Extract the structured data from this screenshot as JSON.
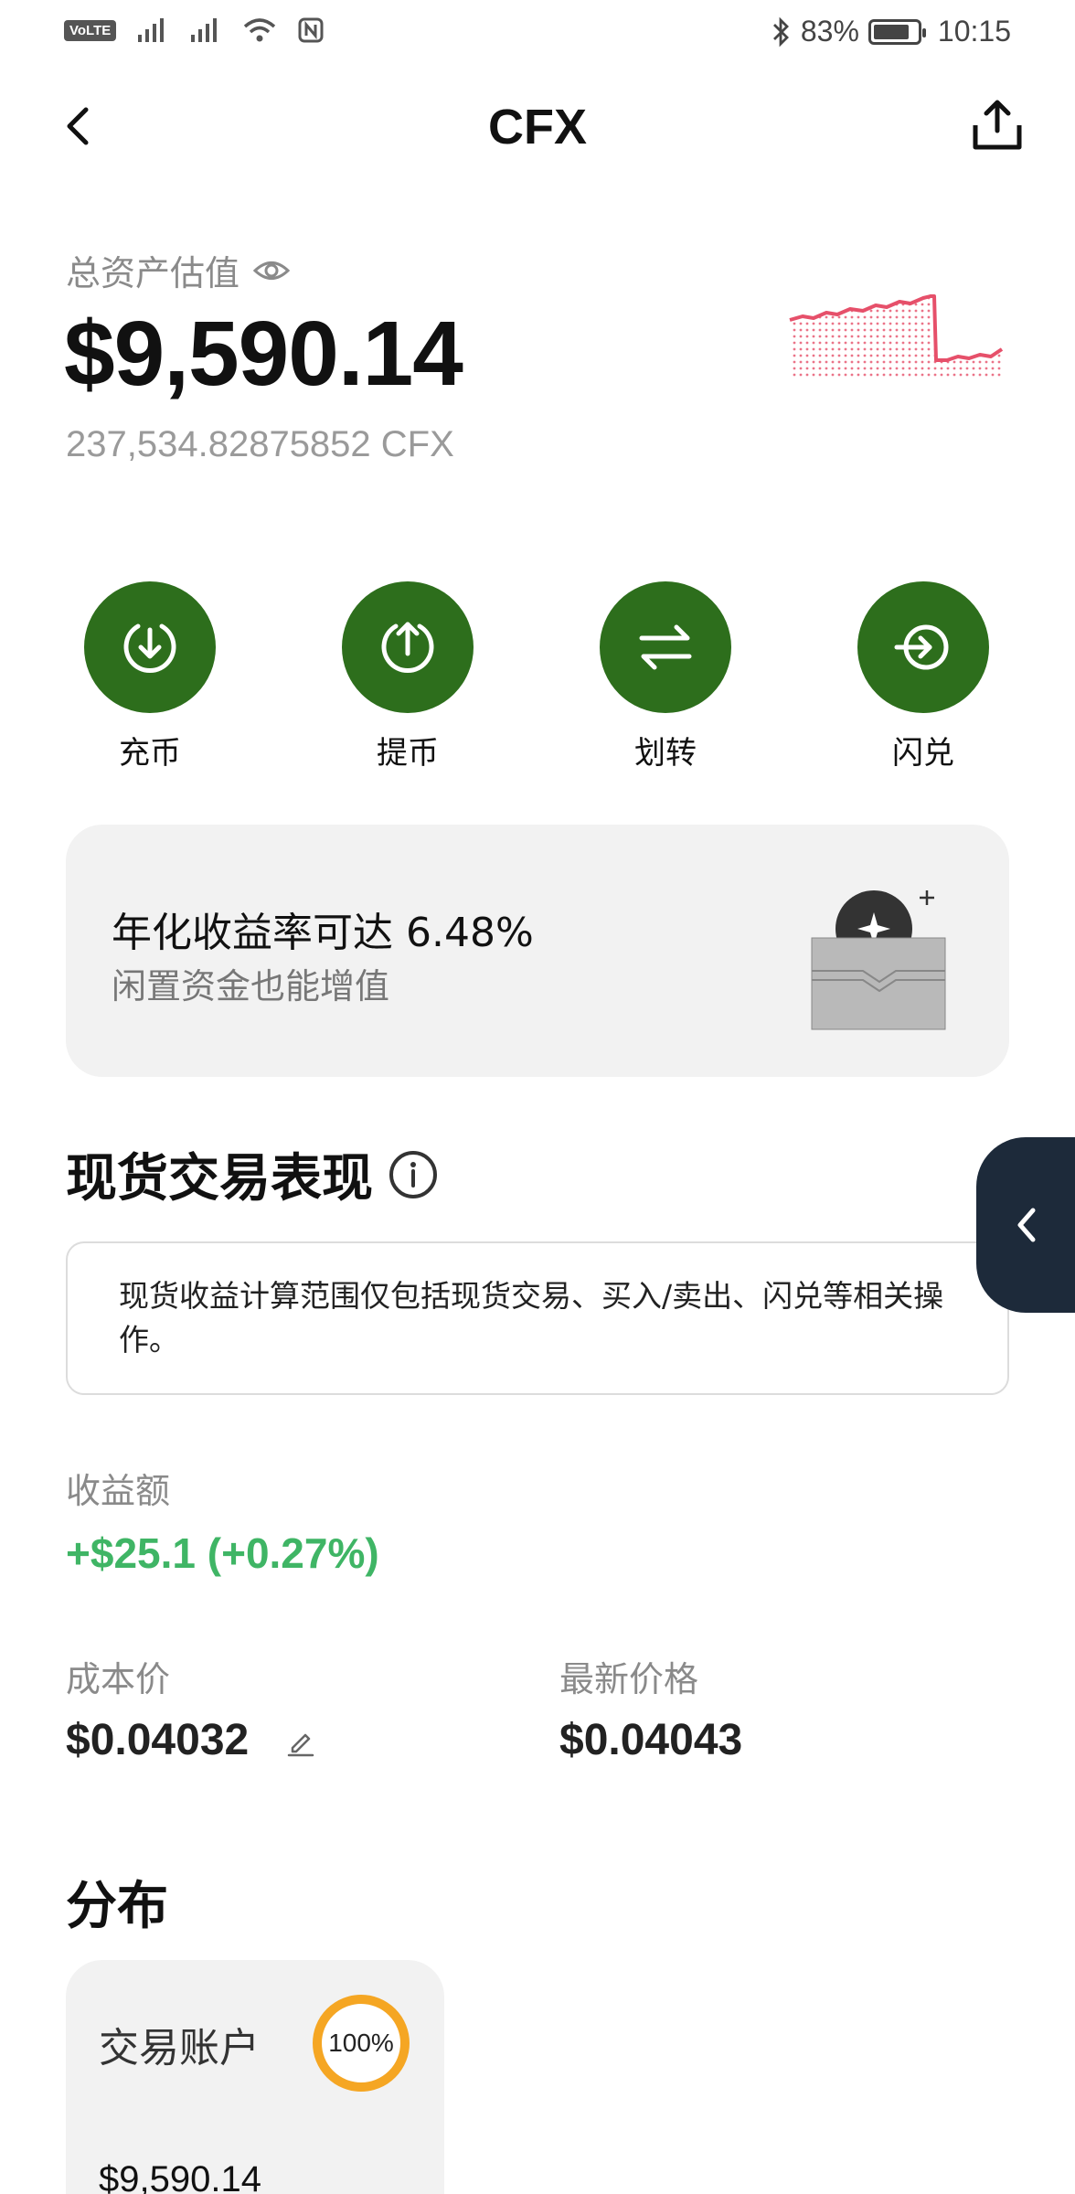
{
  "status_bar": {
    "volte_label": "VoLTE",
    "battery_percent": "83%",
    "time": "10:15",
    "battery_level": 0.83,
    "icons": [
      "volte-icon",
      "signal-icon",
      "signal-icon",
      "wifi-icon",
      "nfc-icon",
      "bluetooth-icon",
      "battery-icon"
    ]
  },
  "header": {
    "title": "CFX"
  },
  "asset": {
    "label": "总资产估值",
    "total": "$9,590.14",
    "amount": "237,534.82875852 CFX"
  },
  "actions": [
    {
      "label": "充币",
      "icon": "deposit-icon"
    },
    {
      "label": "提币",
      "icon": "withdraw-icon"
    },
    {
      "label": "划转",
      "icon": "transfer-icon"
    },
    {
      "label": "闪兑",
      "icon": "convert-icon"
    }
  ],
  "promo": {
    "title": "年化收益率可达 6.48%",
    "subtitle": "闲置资金也能增值"
  },
  "spot": {
    "title": "现货交易表现",
    "note": "现货收益计算范围仅包括现货交易、买入/卖出、闪兑等相关操作。",
    "profit_label": "收益额",
    "profit_value": "+$25.1 (+0.27%)",
    "cost_label": "成本价",
    "cost_value": "$0.04032",
    "latest_label": "最新价格",
    "latest_value": "$0.04043"
  },
  "distribution": {
    "title": "分布",
    "items": [
      {
        "name": "交易账户",
        "percent": "100%",
        "percent_value": 1.0,
        "value": "$9,590.14"
      }
    ]
  },
  "colors": {
    "action_green": "#2d6e1c",
    "profit_green": "#3fb565",
    "sparkline_red": "#e6506a",
    "donut_orange": "#f5a623",
    "side_tab_navy": "#1d2a3a",
    "card_gray": "#f2f2f2"
  }
}
